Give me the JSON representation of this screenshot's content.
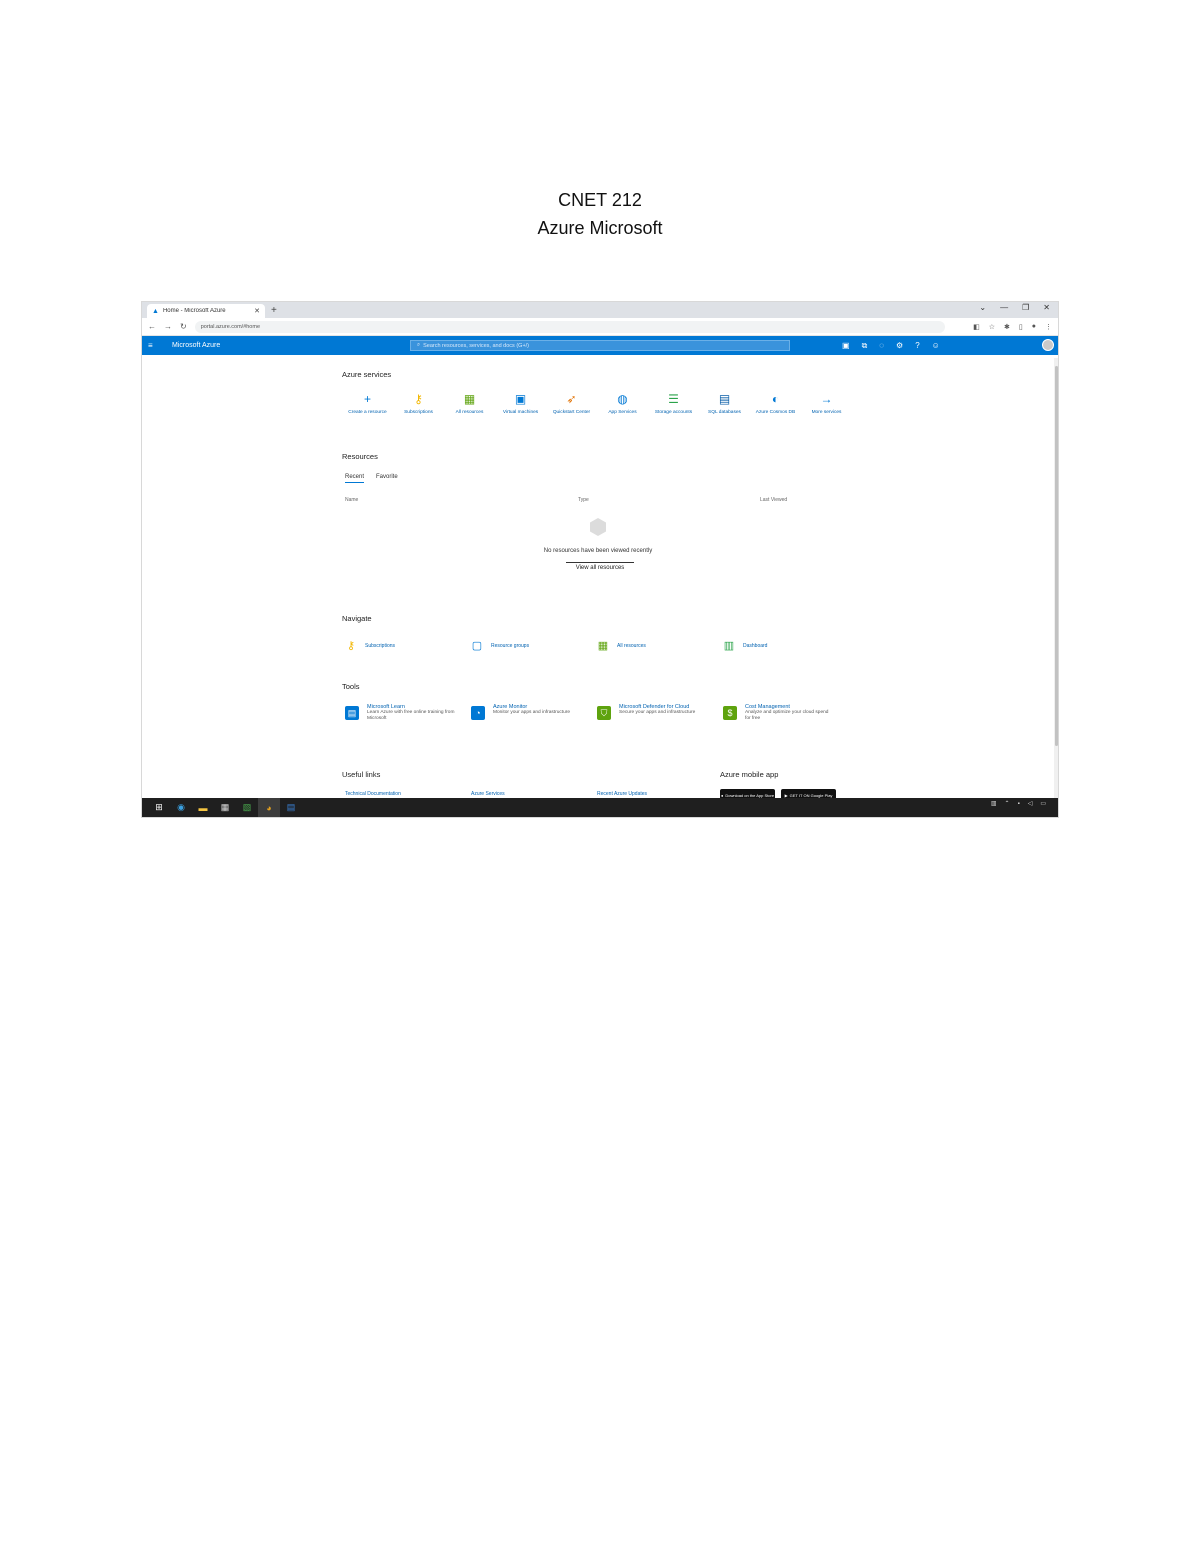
{
  "document": {
    "title_line1": "CNET 212",
    "title_line2": "Azure Microsoft"
  },
  "browser": {
    "tab_label": "Home - Microsoft Azure",
    "url": "portal.azure.com/#home",
    "window_controls": [
      "⌄",
      "—",
      "❐",
      "✕"
    ]
  },
  "azure_header": {
    "brand": "Microsoft Azure",
    "search_placeholder": "Search resources, services, and docs (G+/)",
    "account_line1": "",
    "account_line2": ""
  },
  "azure_services": {
    "title": "Azure services",
    "items": [
      {
        "label": "Create a resource",
        "icon": "plus-icon",
        "color": "#0078d4"
      },
      {
        "label": "Subscriptions",
        "icon": "key-icon",
        "color": "#f2b600"
      },
      {
        "label": "All resources",
        "icon": "grid-icon",
        "color": "#5ea30e"
      },
      {
        "label": "Virtual machines",
        "icon": "monitor-icon",
        "color": "#0078d4"
      },
      {
        "label": "Quickstart Center",
        "icon": "rocket-icon",
        "color": "#e3770c"
      },
      {
        "label": "App Services",
        "icon": "globe-icon",
        "color": "#0078d4"
      },
      {
        "label": "Storage accounts",
        "icon": "storage-icon",
        "color": "#2ba34a"
      },
      {
        "label": "SQL databases",
        "icon": "database-icon",
        "color": "#0b5ea8"
      },
      {
        "label": "Azure Cosmos DB",
        "icon": "planet-icon",
        "color": "#0078d4"
      },
      {
        "label": "More services",
        "icon": "arrow-right-icon",
        "color": "#0078d4"
      }
    ]
  },
  "resources": {
    "title": "Resources",
    "tabs": [
      "Recent",
      "Favorite"
    ],
    "columns": [
      "Name",
      "Type",
      "Last Viewed"
    ],
    "empty_text": "No resources have been viewed recently",
    "see_all": "View all resources"
  },
  "navigate": {
    "title": "Navigate",
    "items": [
      {
        "label": "Subscriptions",
        "icon": "key-icon",
        "color": "#f2b600"
      },
      {
        "label": "Resource groups",
        "icon": "cube-icon",
        "color": "#0078d4"
      },
      {
        "label": "All resources",
        "icon": "grid-icon",
        "color": "#5ea30e"
      },
      {
        "label": "Dashboard",
        "icon": "chart-icon",
        "color": "#2ba34a"
      }
    ]
  },
  "tools": {
    "title": "Tools",
    "items": [
      {
        "name": "Microsoft Learn",
        "desc": "Learn Azure with free online training from Microsoft",
        "icon": "learn-icon",
        "color": "#0078d4",
        "glyph": "▤"
      },
      {
        "name": "Azure Monitor",
        "desc": "Monitor your apps and infrastructure",
        "icon": "gauge-icon",
        "color": "#0078d4",
        "glyph": "◔"
      },
      {
        "name": "Microsoft Defender for Cloud",
        "desc": "Secure your apps and infrastructure",
        "icon": "shield-icon",
        "color": "#5ea30e",
        "glyph": "⛉"
      },
      {
        "name": "Cost Management",
        "desc": "Analyze and optimize your cloud spend for free",
        "icon": "dollar-icon",
        "color": "#5ea30e",
        "glyph": "$"
      }
    ]
  },
  "useful_links": {
    "title": "Useful links",
    "items": [
      "Technical Documentation",
      "Azure Services",
      "Recent Azure Updates"
    ]
  },
  "mobile_app": {
    "title": "Azure mobile app",
    "app_store": "Download on the App Store",
    "google_play": "GET IT ON Google Play"
  },
  "taskbar": {
    "time": "",
    "date": ""
  }
}
